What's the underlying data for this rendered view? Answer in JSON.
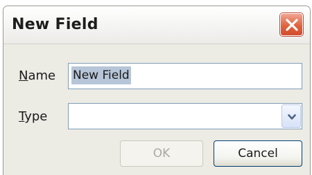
{
  "window": {
    "title": "New Field"
  },
  "form": {
    "name_label_mnemonic": "N",
    "name_label_rest": "ame",
    "name_value": "New Field",
    "type_label_mnemonic": "T",
    "type_label_rest": "ype",
    "type_value": ""
  },
  "buttons": {
    "ok_label": "OK",
    "ok_enabled": false,
    "cancel_label": "Cancel"
  },
  "icons": {
    "close": "close-icon",
    "dropdown": "chevron-down-icon"
  },
  "colors": {
    "close_button": "#e0643f",
    "selection": "#b7c5d8",
    "field_border": "#7f9db9",
    "dialog_background": "#ecebe4"
  }
}
